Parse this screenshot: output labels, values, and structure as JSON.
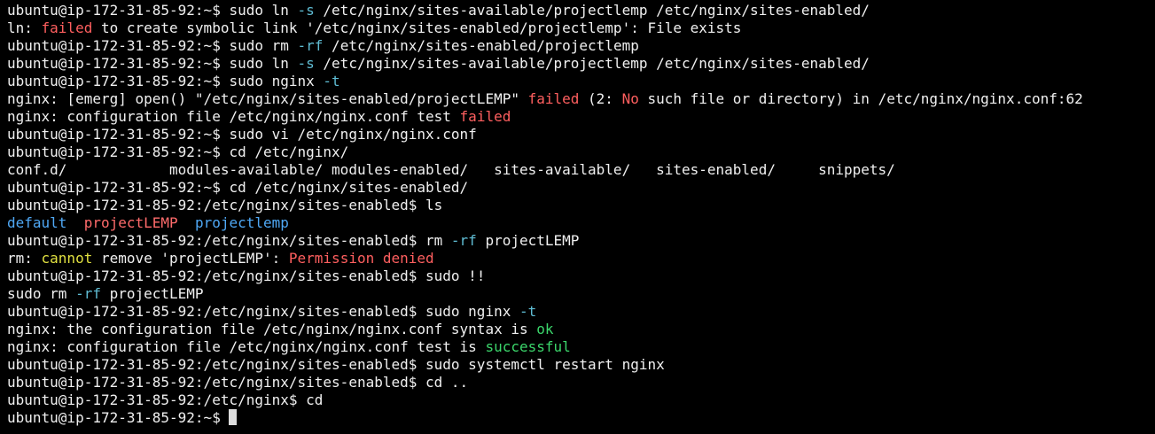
{
  "palette": {
    "default": "#f0f0f0",
    "flag": "#5fbcd3",
    "err": "#ff5f5f",
    "warn": "#e0e040",
    "ok": "#3bd66b",
    "dir": "#4fa8f5",
    "file": "#ff6b6b"
  },
  "terminal": {
    "lines": [
      [
        {
          "t": "ubuntu@ip-172-31-85-92:~$ sudo ln ",
          "c": "default"
        },
        {
          "t": "-s",
          "c": "flag"
        },
        {
          "t": " /etc/nginx/sites-available/projectlemp /etc/nginx/sites-enabled/",
          "c": "default"
        }
      ],
      [
        {
          "t": "ln: ",
          "c": "default"
        },
        {
          "t": "failed",
          "c": "err"
        },
        {
          "t": " to create symbolic link '/etc/nginx/sites-enabled/projectlemp': File exists",
          "c": "default"
        }
      ],
      [
        {
          "t": "ubuntu@ip-172-31-85-92:~$ sudo rm ",
          "c": "default"
        },
        {
          "t": "-rf",
          "c": "flag"
        },
        {
          "t": " /etc/nginx/sites-enabled/projectlemp",
          "c": "default"
        }
      ],
      [
        {
          "t": "ubuntu@ip-172-31-85-92:~$ sudo ln ",
          "c": "default"
        },
        {
          "t": "-s",
          "c": "flag"
        },
        {
          "t": " /etc/nginx/sites-available/projectlemp /etc/nginx/sites-enabled/",
          "c": "default"
        }
      ],
      [
        {
          "t": "ubuntu@ip-172-31-85-92:~$ sudo nginx ",
          "c": "default"
        },
        {
          "t": "-t",
          "c": "flag"
        }
      ],
      [
        {
          "t": "nginx: [emerg] open() \"/etc/nginx/sites-enabled/projectLEMP\" ",
          "c": "default"
        },
        {
          "t": "failed",
          "c": "err"
        },
        {
          "t": " (2: ",
          "c": "default"
        },
        {
          "t": "No",
          "c": "err"
        },
        {
          "t": " such file or directory) in /etc/nginx/nginx.conf:62",
          "c": "default"
        }
      ],
      [
        {
          "t": "nginx: configuration file /etc/nginx/nginx.conf test ",
          "c": "default"
        },
        {
          "t": "failed",
          "c": "err"
        }
      ],
      [
        {
          "t": "ubuntu@ip-172-31-85-92:~$ sudo vi /etc/nginx/nginx.conf",
          "c": "default"
        }
      ],
      [
        {
          "t": "ubuntu@ip-172-31-85-92:~$ cd /etc/nginx/",
          "c": "default"
        }
      ],
      [
        {
          "t": "conf.d/            modules-available/ modules-enabled/   sites-available/   sites-enabled/     snippets/",
          "c": "default"
        }
      ],
      [
        {
          "t": "ubuntu@ip-172-31-85-92:~$ cd /etc/nginx/sites-enabled/",
          "c": "default"
        }
      ],
      [
        {
          "t": "ubuntu@ip-172-31-85-92:/etc/nginx/sites-enabled$ ls",
          "c": "default"
        }
      ],
      [
        {
          "t": "default",
          "c": "dir"
        },
        {
          "t": "  ",
          "c": "default"
        },
        {
          "t": "projectLEMP",
          "c": "file"
        },
        {
          "t": "  ",
          "c": "default"
        },
        {
          "t": "projectlemp",
          "c": "dir"
        }
      ],
      [
        {
          "t": "ubuntu@ip-172-31-85-92:/etc/nginx/sites-enabled$ rm ",
          "c": "default"
        },
        {
          "t": "-rf",
          "c": "flag"
        },
        {
          "t": " projectLEMP",
          "c": "default"
        }
      ],
      [
        {
          "t": "rm: ",
          "c": "default"
        },
        {
          "t": "cannot",
          "c": "warn"
        },
        {
          "t": " remove 'projectLEMP': ",
          "c": "default"
        },
        {
          "t": "Permission denied",
          "c": "err"
        }
      ],
      [
        {
          "t": "ubuntu@ip-172-31-85-92:/etc/nginx/sites-enabled$ sudo !!",
          "c": "default"
        }
      ],
      [
        {
          "t": "sudo rm ",
          "c": "default"
        },
        {
          "t": "-rf",
          "c": "flag"
        },
        {
          "t": " projectLEMP",
          "c": "default"
        }
      ],
      [
        {
          "t": "ubuntu@ip-172-31-85-92:/etc/nginx/sites-enabled$ sudo nginx ",
          "c": "default"
        },
        {
          "t": "-t",
          "c": "flag"
        }
      ],
      [
        {
          "t": "nginx: the configuration file /etc/nginx/nginx.conf syntax is ",
          "c": "default"
        },
        {
          "t": "ok",
          "c": "ok"
        }
      ],
      [
        {
          "t": "nginx: configuration file /etc/nginx/nginx.conf test is ",
          "c": "default"
        },
        {
          "t": "successful",
          "c": "ok"
        }
      ],
      [
        {
          "t": "ubuntu@ip-172-31-85-92:/etc/nginx/sites-enabled$ sudo systemctl restart nginx",
          "c": "default"
        }
      ],
      [
        {
          "t": "ubuntu@ip-172-31-85-92:/etc/nginx/sites-enabled$ cd ..",
          "c": "default"
        }
      ],
      [
        {
          "t": "ubuntu@ip-172-31-85-92:/etc/nginx$ cd",
          "c": "default"
        }
      ]
    ],
    "prompt": "ubuntu@ip-172-31-85-92:~$ "
  }
}
